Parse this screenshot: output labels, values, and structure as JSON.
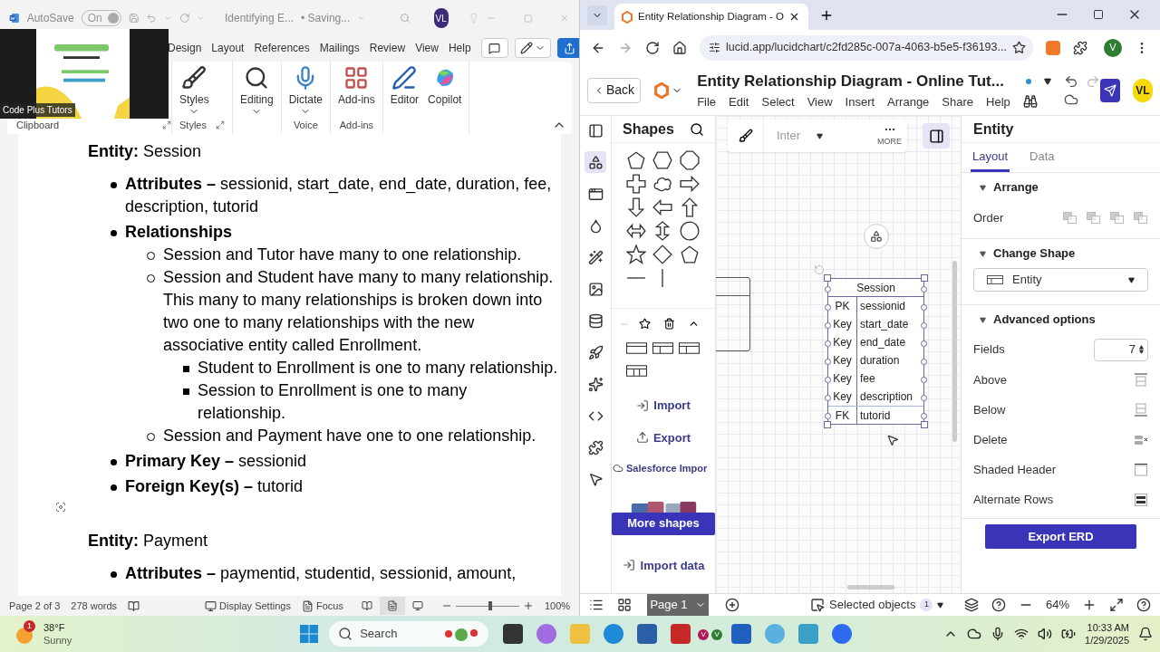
{
  "word": {
    "title_bar": {
      "autosave_label": "AutoSave",
      "autosave": {
        "label": "On",
        "on": true
      },
      "document_title": "Identifying E...",
      "save_status": "• Saving...",
      "avatar": "VL"
    },
    "webcam": {
      "name_tag": "Code Plus Tutors"
    },
    "ribbon_tabs": [
      "Design",
      "Layout",
      "References",
      "Mailings",
      "Review",
      "View",
      "Help"
    ],
    "ribbon_groups": [
      {
        "label": "Clipboard",
        "launcher": true
      },
      {
        "label": "Styles",
        "launcher": true,
        "buttons": [
          {
            "label": "Styles",
            "dropdown": true
          }
        ]
      },
      {
        "buttons": [
          {
            "label": "Editing",
            "dropdown": true
          }
        ]
      },
      {
        "label": "Voice",
        "launcher": false,
        "buttons": [
          {
            "label": "Dictate",
            "dropdown": true
          }
        ]
      },
      {
        "label": "Add-ins",
        "launcher": false,
        "buttons": [
          {
            "label": "Add-ins",
            "dropdown": false
          }
        ]
      },
      {
        "buttons": [
          {
            "label": "Editor",
            "dropdown": false
          },
          {
            "label": "Copilot",
            "dropdown": false
          }
        ]
      }
    ],
    "document": {
      "sections": [
        {
          "heading": "**Entity:** Session",
          "items": [
            {
              "text": "**Attributes –** sessionid, start_date, end_date, duration, fee, description, tutorid"
            },
            {
              "text": "**Relationships**",
              "children": [
                {
                  "text": "Session and Tutor have many to one relationship."
                },
                {
                  "text": "Session and Student have many to many relationship. This many to many relationships is broken down into two one to many relationships with the new associative entity called Enrollment.",
                  "children": [
                    {
                      "text": "Student to Enrollment is one to many relationship."
                    },
                    {
                      "text": "Session to Enrollment is one to many relationship."
                    }
                  ]
                },
                {
                  "text": "Session and Payment have one to one relationship."
                }
              ]
            },
            {
              "text": "**Primary Key –** sessionid"
            },
            {
              "text": "**Foreign Key(s) –** tutorid"
            }
          ]
        },
        {
          "heading": "**Entity:** Payment",
          "items": [
            {
              "text": "**Attributes –** paymentid, studentid, sessionid, amount,"
            }
          ]
        }
      ]
    },
    "status_bar": {
      "page": "Page 2 of 3",
      "words": "278 words",
      "display_settings": "Display Settings",
      "focus": "Focus",
      "views": [
        {
          "selected": false
        },
        {
          "selected": true
        },
        {
          "selected": false
        }
      ],
      "zoom_slider": {
        "level": 0.55
      },
      "zoom": "100%"
    }
  },
  "browser": {
    "tab": {
      "title": "Entity Relationship Diagram - O"
    },
    "url": "lucid.app/lucidchart/c2fd285c-007a-4063-b5e5-f36193...",
    "profile": "V",
    "app": {
      "back": "Back",
      "title": "Entity Relationship Diagram - Online Tut...",
      "menu": [
        "File",
        "Edit",
        "Select",
        "View",
        "Insert",
        "Arrange",
        "Share",
        "Help"
      ],
      "avatar": "VL"
    },
    "shapes_panel": {
      "title": "Shapes",
      "actions": [
        "Import",
        "Export",
        "Salesforce Impor"
      ],
      "more_shapes": "More shapes",
      "import_data": "Import data"
    },
    "toolbar": {
      "font": "Inter",
      "more": "MORE"
    },
    "entity": {
      "title": "Session",
      "fields": [
        {
          "key": "PK",
          "name": "sessionid"
        },
        {
          "key": "Key",
          "name": "start_date"
        },
        {
          "key": "Key",
          "name": "end_date"
        },
        {
          "key": "Key",
          "name": "duration"
        },
        {
          "key": "Key",
          "name": "fee"
        },
        {
          "key": "Key",
          "name": "description"
        },
        {
          "key": "FK",
          "name": "tutorid"
        }
      ]
    },
    "properties": {
      "title": "Entity",
      "tabs": [
        {
          "label": "Layout",
          "selected": true
        },
        {
          "label": "Data",
          "selected": false
        }
      ],
      "sections": [
        {
          "title": "Arrange",
          "expanded": true,
          "rows": [
            {
              "kind": "order",
              "label": "Order"
            }
          ]
        },
        {
          "title": "Change Shape",
          "expanded": true,
          "rows": [
            {
              "kind": "select",
              "value": "Entity"
            }
          ]
        },
        {
          "title": "Advanced options",
          "expanded": true,
          "rows": [
            {
              "kind": "spinner",
              "label": "Fields",
              "value": "7"
            },
            {
              "kind": "icon",
              "label": "Above"
            },
            {
              "kind": "icon",
              "label": "Below"
            },
            {
              "kind": "icon",
              "label": "Delete"
            },
            {
              "kind": "icon",
              "label": "Shaded Header"
            },
            {
              "kind": "icon",
              "label": "Alternate Rows"
            }
          ]
        }
      ],
      "export_button": "Export ERD"
    },
    "bottom_bar": {
      "page": "Page 1",
      "selected_objects": "Selected objects",
      "count": "1",
      "zoom": "64%"
    }
  },
  "taskbar": {
    "weather": {
      "badge": "1",
      "temperature": "38°F",
      "condition": "Sunny"
    },
    "search": "Search",
    "chrome_badges": [
      "V",
      "V"
    ],
    "time": "10:33 AM",
    "date": "1/29/2025"
  }
}
